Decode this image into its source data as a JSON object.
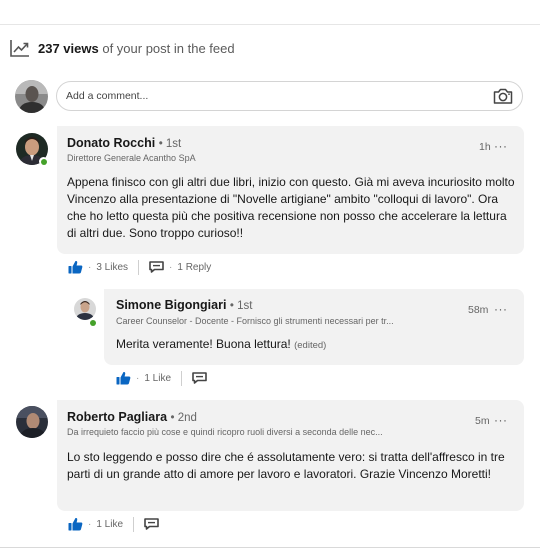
{
  "views": {
    "count": "237 views",
    "suffix": "of your post in the feed"
  },
  "comment_input": {
    "placeholder": "Add a comment..."
  },
  "comments": [
    {
      "name": "Donato Rocchi",
      "degree": "• 1st",
      "headline": "Direttore Generale Acantho SpA",
      "time": "1h",
      "text": "Appena finisco con gli altri due libri,  inizio con questo. Già mi aveva incuriosito molto Vincenzo alla presentazione di \"Novelle artigiane\" ambito \"colloqui di lavoro\". Ora che ho letto questa più che positiva recensione non posso che accelerare la lettura di altri due. Sono troppo curioso!!",
      "likes": "3 Likes",
      "replies": "1 Reply",
      "reply": {
        "name": "Simone Bigongiari",
        "degree": "• 1st",
        "headline": "Career Counselor - Docente - Fornisco gli strumenti necessari per tr...",
        "time": "58m",
        "text": "Merita veramente! Buona lettura!",
        "edited": "(edited)",
        "likes": "1 Like"
      }
    },
    {
      "name": "Roberto Pagliara",
      "degree": "• 2nd",
      "headline": "Da irrequieto faccio più cose e quindi ricopro ruoli diversi a seconda delle nec...",
      "time": "5m",
      "text": "Lo sto leggendo e posso dire che é assolutamente vero: si tratta dell'affresco in tre parti di un grande atto di amore per lavoro e lavoratori. Grazie Vincenzo Moretti!",
      "likes": "1 Like"
    }
  ],
  "more_label": "···",
  "colors": {
    "like_blue": "#0a66c2",
    "online_green": "#45a12a",
    "bubble_bg": "#f2f2f2"
  }
}
